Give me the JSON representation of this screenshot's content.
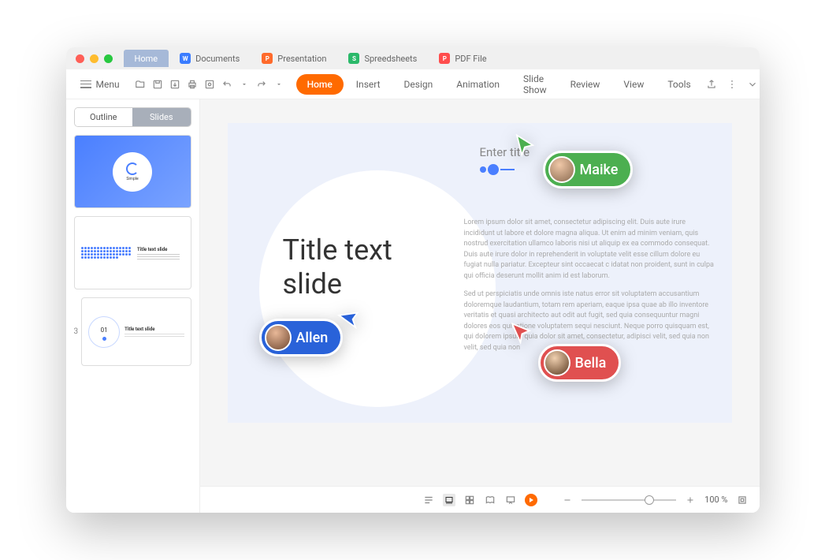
{
  "tabs": {
    "home": "Home",
    "documents": "Documents",
    "presentation": "Presentation",
    "spreadsheets": "Spreedsheets",
    "pdf": "PDF File"
  },
  "menu_label": "Menu",
  "ribbon": {
    "home": "Home",
    "insert": "Insert",
    "design": "Design",
    "animation": "Animation",
    "slideshow": "Slide Show",
    "review": "Review",
    "view": "View",
    "tools": "Tools"
  },
  "sidebar": {
    "outline": "Outline",
    "slides": "Slides",
    "thumb1_label": "Simple",
    "thumb2_title": "Title text slide",
    "thumb3_num": "01",
    "thumb3_title": "Title text slide",
    "thumb3_index": "3"
  },
  "slide": {
    "title": "Title text slide",
    "enter_title": "Enter title",
    "para1": "Lorem ipsum dolor sit amet, consectetur adipiscing elit. Duis aute irure incididunt ut labore et dolore magna aliqua. Ut enim ad minim veniam, quis nostrud exercitation ullamco laboris nisi ut aliquip ex ea commodo consequat. Duis aute irure dolor in reprehenderit in voluptate velit esse cillum dolore eu fugiat nulla pariatur. Excepteur sint occaecat c idatat non proident, sunt in culpa qui officia deserunt mollit anim id est laborum.",
    "para2": "Sed ut perspiciatis unde omnis iste natus error sit voluptatem accusantium doloremque laudantium, totam rem aperiam, eaque ipsa quae ab illo inventore veritatis et quasi architecto aut odit aut fugit, sed quia consequuntur magni dolores eos qui ratione voluptatem sequi nesciunt. Neque porro quisquam est, qui dolorem ipsum quia dolor sit amet, consectetur, adipisci velit, sed quia non velit, sed quia non"
  },
  "collaborators": {
    "maike": "Maike",
    "allen": "Allen",
    "bella": "Bella"
  },
  "statusbar": {
    "zoom": "100 %"
  }
}
